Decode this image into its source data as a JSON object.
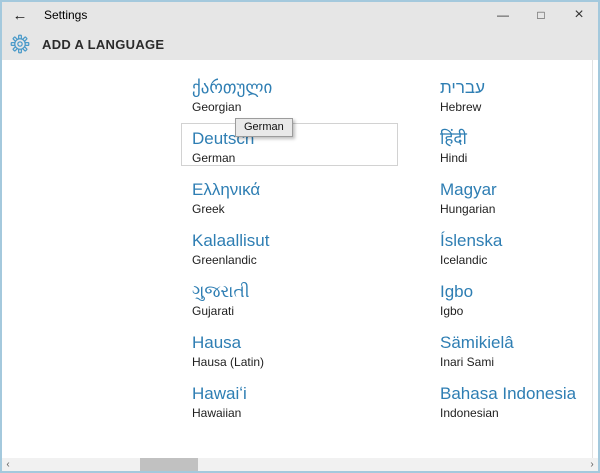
{
  "window": {
    "title": "Settings",
    "back_glyph": "←",
    "controls": {
      "minimize_glyph": "—",
      "maximize_glyph": "□",
      "close_glyph": "×"
    }
  },
  "header": {
    "title": "ADD A LANGUAGE"
  },
  "tooltip": {
    "text": "German"
  },
  "languages": {
    "left": [
      {
        "native": "ქართული",
        "english": "Georgian"
      },
      {
        "native": "Deutsch",
        "english": "German",
        "hovered": true
      },
      {
        "native": "Ελληνικά",
        "english": "Greek"
      },
      {
        "native": "Kalaallisut",
        "english": "Greenlandic"
      },
      {
        "native": "ગુજરાતી",
        "english": "Gujarati"
      },
      {
        "native": "Hausa",
        "english": "Hausa (Latin)"
      },
      {
        "native": "Hawaiʻi",
        "english": "Hawaiian"
      }
    ],
    "right": [
      {
        "native": "עברית",
        "english": "Hebrew"
      },
      {
        "native": "हिंदी",
        "english": "Hindi"
      },
      {
        "native": "Magyar",
        "english": "Hungarian"
      },
      {
        "native": "Íslenska",
        "english": "Icelandic"
      },
      {
        "native": "Igbo",
        "english": "Igbo"
      },
      {
        "native": "Sämikielâ",
        "english": "Inari Sami"
      },
      {
        "native": "Bahasa Indonesia",
        "english": "Indonesian"
      }
    ]
  },
  "scrollbar": {
    "left_arrow_glyph": "‹",
    "right_arrow_glyph": "›"
  },
  "colors": {
    "window_border": "#a4c9dd",
    "titlebar_bg": "#e6e6e6",
    "content_bg": "#ffffff",
    "accent_text": "#2e7eb3",
    "english_text": "#1e1e1e",
    "gear_icon": "#4a9ac9",
    "scrollbar_track": "#f1f1f1",
    "scrollbar_thumb": "#c1c1c1",
    "tooltip_bg": "#e9e9e9",
    "tooltip_border": "#9c9c9c",
    "hover_border": "#d2d2d2"
  }
}
